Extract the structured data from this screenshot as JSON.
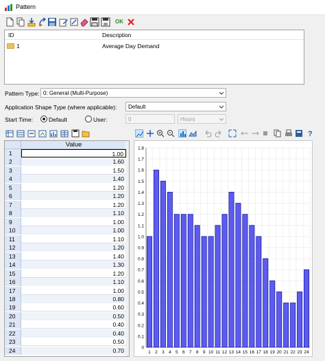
{
  "window": {
    "title": "Pattern"
  },
  "toolbar": {
    "icons": [
      "new-icon",
      "copy-icon",
      "import-icon",
      "export-icon",
      "edit-icon",
      "note-icon",
      "erase-icon",
      "save-icon",
      "save-as-icon"
    ],
    "ok_label": "OK",
    "cancel_icon": "close-icon"
  },
  "list": {
    "col_id": "ID",
    "col_desc": "Description",
    "rows": [
      {
        "id": "1",
        "description": "Average Day Demand"
      }
    ]
  },
  "form": {
    "pattern_type_label": "Pattern Type:",
    "pattern_type_value": "0: General (Multi-Purpose)",
    "shape_type_label": "Application Shape Type (where applicable):",
    "shape_type_value": "Default",
    "start_time_label": "Start Time:",
    "radio_default_label": "Default",
    "radio_user_label": "User:",
    "user_value": "0",
    "unit_value": "Hours"
  },
  "grid": {
    "column_header": "Value",
    "rows": [
      {
        "n": "1",
        "v": "1.00"
      },
      {
        "n": "2",
        "v": "1.60"
      },
      {
        "n": "3",
        "v": "1.50"
      },
      {
        "n": "4",
        "v": "1.40"
      },
      {
        "n": "5",
        "v": "1.20"
      },
      {
        "n": "6",
        "v": "1.20"
      },
      {
        "n": "7",
        "v": "1.20"
      },
      {
        "n": "8",
        "v": "1.10"
      },
      {
        "n": "9",
        "v": "1.00"
      },
      {
        "n": "10",
        "v": "1.00"
      },
      {
        "n": "11",
        "v": "1.10"
      },
      {
        "n": "12",
        "v": "1.20"
      },
      {
        "n": "13",
        "v": "1.40"
      },
      {
        "n": "14",
        "v": "1.30"
      },
      {
        "n": "15",
        "v": "1.20"
      },
      {
        "n": "16",
        "v": "1.10"
      },
      {
        "n": "17",
        "v": "1.00"
      },
      {
        "n": "18",
        "v": "0.80"
      },
      {
        "n": "19",
        "v": "0.60"
      },
      {
        "n": "20",
        "v": "0.50"
      },
      {
        "n": "21",
        "v": "0.40"
      },
      {
        "n": "22",
        "v": "0.40"
      },
      {
        "n": "23",
        "v": "0.50"
      },
      {
        "n": "24",
        "v": "0.70"
      }
    ]
  },
  "colors": {
    "bar_fill": "#5c5cf0",
    "bar_stroke": "#1c1ca8",
    "grid_alt": "#eef3fa",
    "header_bg": "#dce6f4"
  },
  "chart_data": {
    "type": "bar",
    "categories": [
      "1",
      "2",
      "3",
      "4",
      "5",
      "6",
      "7",
      "8",
      "9",
      "10",
      "11",
      "12",
      "13",
      "14",
      "15",
      "16",
      "17",
      "18",
      "19",
      "20",
      "21",
      "22",
      "23",
      "24"
    ],
    "values": [
      1.0,
      1.6,
      1.5,
      1.4,
      1.2,
      1.2,
      1.2,
      1.1,
      1.0,
      1.0,
      1.1,
      1.2,
      1.4,
      1.3,
      1.2,
      1.1,
      1.0,
      0.8,
      0.6,
      0.5,
      0.4,
      0.4,
      0.5,
      0.7
    ],
    "yticks": [
      "0",
      "0.1",
      "0.2",
      "0.3",
      "0.4",
      "0.5",
      "0.6",
      "0.7",
      "0.8",
      "0.9",
      "1.0",
      "1.1",
      "1.2",
      "1.3",
      "1.4",
      "1.5",
      "1.6",
      "1.7",
      "1.8"
    ],
    "ylim": [
      0,
      1.8
    ],
    "grid": true
  }
}
